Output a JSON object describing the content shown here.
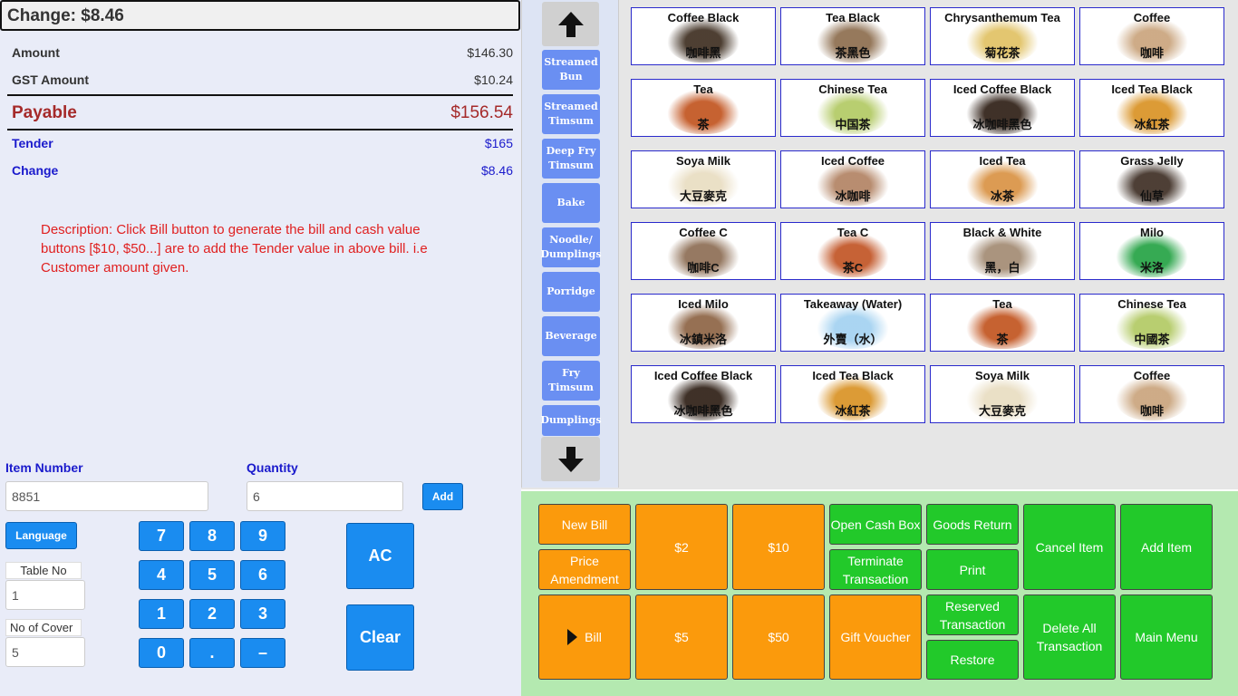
{
  "summary": {
    "change_header": "Change: $8.46",
    "amount_label": "Amount",
    "amount_value": "$146.30",
    "gst_label": "GST Amount",
    "gst_value": "$10.24",
    "payable_label": "Payable",
    "payable_value": "$156.54",
    "tender_label": "Tender",
    "tender_value": "$165",
    "change_label": "Change",
    "change_value": "$8.46"
  },
  "description": "Description: Click Bill button to generate the bill and cash value buttons [$10, $50...] are to add the Tender value in above bill. i.e Customer amount given.",
  "entry": {
    "item_number_label": "Item Number",
    "item_number_value": "8851",
    "quantity_label": "Quantity",
    "quantity_value": "6",
    "add_label": "Add",
    "language_label": "Language",
    "table_no_label": "Table No",
    "table_no_value": "1",
    "cover_label": "No of Cover",
    "cover_value": "5",
    "ac_label": "AC",
    "clear_label": "Clear"
  },
  "keypad": [
    "7",
    "8",
    "9",
    "4",
    "5",
    "6",
    "1",
    "2",
    "3",
    "0",
    ".",
    "–"
  ],
  "categories": [
    {
      "label": "Streamed Bun"
    },
    {
      "label": "Streamed Timsum"
    },
    {
      "label": "Deep Fry Timsum"
    },
    {
      "label": "Bake"
    },
    {
      "label": "Noodle/ Dumplings"
    },
    {
      "label": "Porridge"
    },
    {
      "label": "Beverage"
    },
    {
      "label": "Fry Timsum"
    },
    {
      "label": "Dumplings"
    }
  ],
  "items": [
    {
      "en": "Coffee Black",
      "zh": "咖啡黑",
      "color": "#3a2a1c"
    },
    {
      "en": "Tea Black",
      "zh": "茶黑色",
      "color": "#8a6a4a"
    },
    {
      "en": "Chrysanthemum Tea",
      "zh": "菊花茶",
      "color": "#e0c060"
    },
    {
      "en": "Coffee",
      "zh": "咖啡",
      "color": "#c8a27a"
    },
    {
      "en": "Tea",
      "zh": "茶",
      "color": "#c0501a"
    },
    {
      "en": "Chinese Tea",
      "zh": "中国茶",
      "color": "#b0c860"
    },
    {
      "en": "Iced Coffee Black",
      "zh": "冰咖啡黑色",
      "color": "#2a1a10"
    },
    {
      "en": "Iced Tea Black",
      "zh": "冰紅茶",
      "color": "#d89020"
    },
    {
      "en": "Soya Milk",
      "zh": "大豆麥克",
      "color": "#e8dcc0"
    },
    {
      "en": "Iced Coffee",
      "zh": "冰咖啡",
      "color": "#b08060"
    },
    {
      "en": "Iced Tea",
      "zh": "冰茶",
      "color": "#d89040"
    },
    {
      "en": "Grass Jelly",
      "zh": "仙草",
      "color": "#3a2a20"
    },
    {
      "en": "Coffee C",
      "zh": "咖啡C",
      "color": "#8a6a50"
    },
    {
      "en": "Tea C",
      "zh": "茶C",
      "color": "#c05020"
    },
    {
      "en": "Black & White",
      "zh": "黑，白",
      "color": "#a08870"
    },
    {
      "en": "Milo",
      "zh": "米洛",
      "color": "#20a040"
    },
    {
      "en": "Iced Milo",
      "zh": "冰鎮米洛",
      "color": "#8a6040"
    },
    {
      "en": "Takeaway (Water)",
      "zh": "外賣（水）",
      "color": "#a0d0f0"
    },
    {
      "en": "Tea",
      "zh": "茶",
      "color": "#c0501a"
    },
    {
      "en": "Chinese Tea",
      "zh": "中國茶",
      "color": "#b0c860"
    },
    {
      "en": "Iced Coffee Black",
      "zh": "冰咖啡黑色",
      "color": "#2a1a10"
    },
    {
      "en": "Iced Tea Black",
      "zh": "冰紅茶",
      "color": "#d89020"
    },
    {
      "en": "Soya Milk",
      "zh": "大豆麥克",
      "color": "#e8dcc0"
    },
    {
      "en": "Coffee",
      "zh": "咖啡",
      "color": "#c8a27a"
    }
  ],
  "actions": {
    "new_bill": "New Bill",
    "price_amendment": "Price Amendment",
    "bill": "Bill",
    "cash_2": "$2",
    "cash_10": "$10",
    "cash_5": "$5",
    "cash_50": "$50",
    "open_cash_box": "Open Cash Box",
    "terminate_transaction": "Terminate Transaction",
    "gift_voucher": "Gift Voucher",
    "goods_return": "Goods Return",
    "print": "Print",
    "reserved_transaction": "Reserved Transaction",
    "restore": "Restore",
    "cancel_item": "Cancel Item",
    "delete_all_transaction": "Delete All Transaction",
    "add_item": "Add Item",
    "main_menu": "Main Menu"
  },
  "colors": {
    "orange": "#fb9a0c",
    "green": "#22c92a",
    "blue": "#1a8cf0",
    "payable": "#a52a2a",
    "description": "#e02020"
  }
}
